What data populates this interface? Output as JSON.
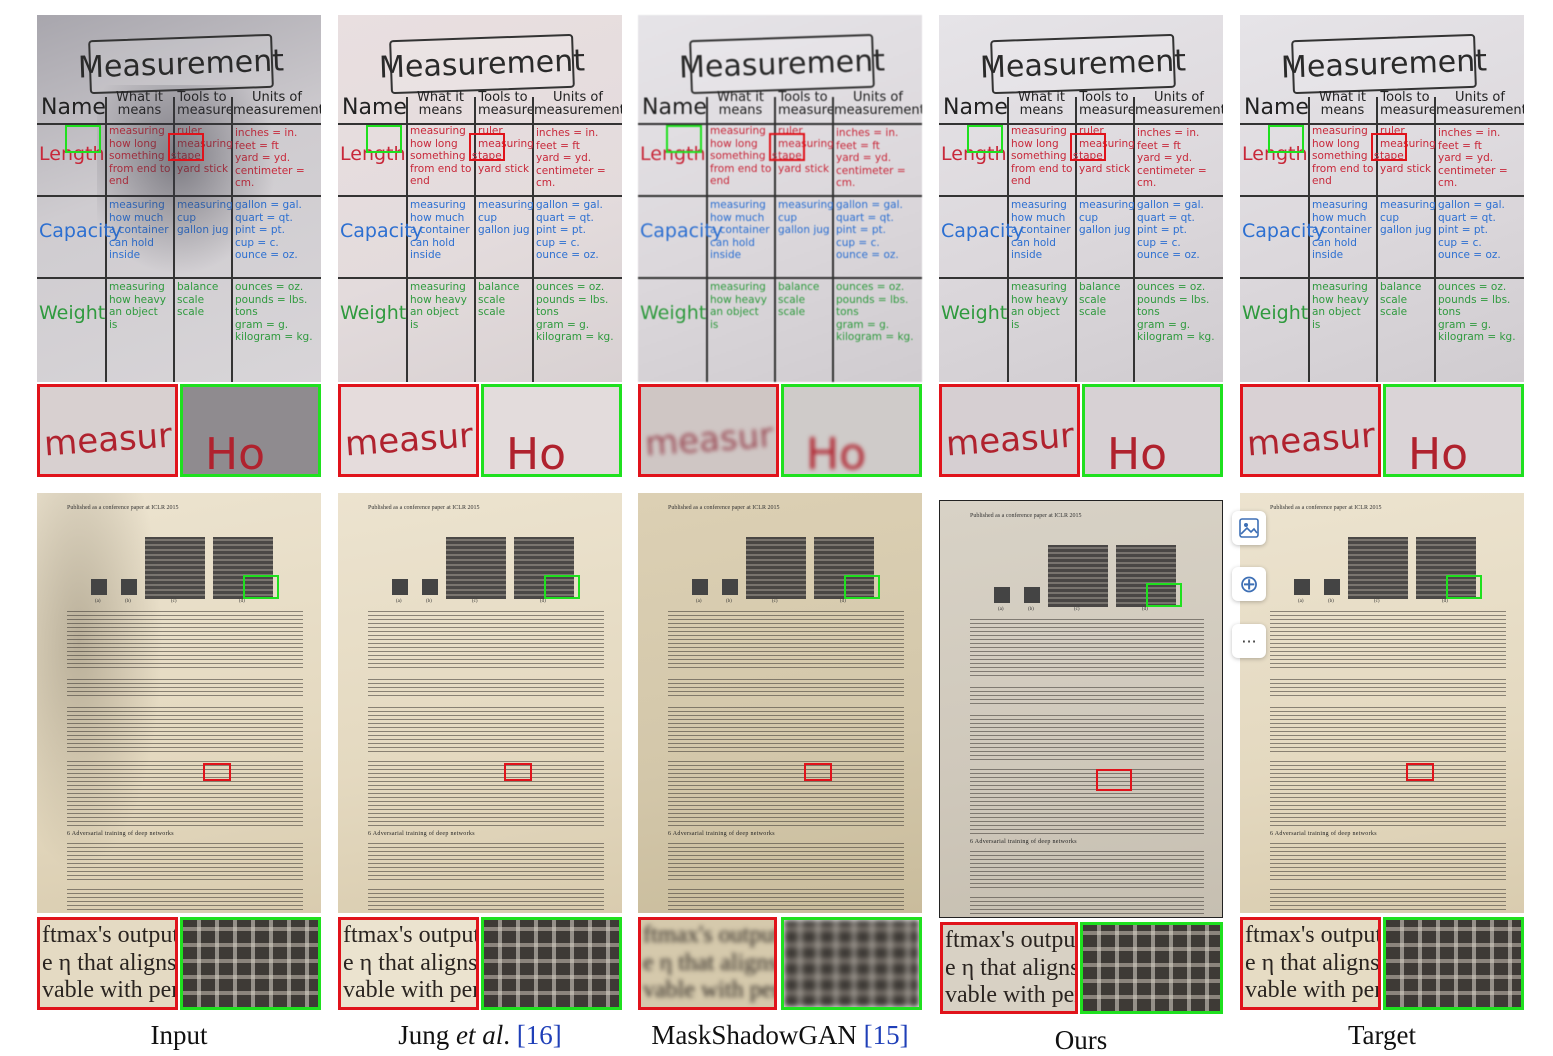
{
  "captions": {
    "input": "Input",
    "jung": "Jung ",
    "jung_etal": "et al",
    "jung_dot": ". ",
    "jung_ref": "[16]",
    "maskshadow": "MaskShadowGAN ",
    "maskshadow_ref": "[15]",
    "ours": "Ours",
    "target": "Target"
  },
  "chart": {
    "title": "Measurement",
    "headers": {
      "name": "Name",
      "what": "What it means",
      "tools": "Tools to measure",
      "units": "Units of measurement"
    },
    "rows": [
      {
        "label": "Length",
        "meaning": "measuring\nhow long\nsomething is\nfrom end to\nend",
        "tools": "ruler\nmeasuring\ntape\nyard stick",
        "units": "inches = in.\nfeet = ft\nyard = yd.\ncentimeter = cm."
      },
      {
        "label": "Capacity",
        "meaning": "measuring\nhow much\na container\ncan hold\ninside",
        "tools": "measuring\ncup\ngallon jug",
        "units": "gallon = gal.\nquart = qt.\npint = pt.\ncup = c.\nounce = oz."
      },
      {
        "label": "Weight",
        "meaning": "measuring\nhow heavy\nan object\nis",
        "tools": "balance\nscale\nscale",
        "units": "ounces = oz.\npounds = lbs.\ntons\ngram = g.\nkilogram = kg."
      }
    ]
  },
  "zoom_text": {
    "measur": "measur",
    "len_fragment": "Ho"
  },
  "doc": {
    "header": "Published as a conference paper at ICLR 2015",
    "sublabels": [
      "(a)",
      "(b)",
      "(c)",
      "(d)"
    ],
    "section": "6   Adversarial training of deep networks",
    "zoom_lines": "ftmax's output\ne η that aligns\nvable with per"
  },
  "colors": {
    "red_box": "#e0131b",
    "green_box": "#1fe01f",
    "length": "#c8283a",
    "capacity": "#2c6fd1",
    "weight": "#2f9a3e",
    "link": "#1f3fb8"
  },
  "side_icons": [
    "image-icon",
    "zoom-in-icon",
    "more-icon"
  ],
  "side_icon_glyphs": {
    "zoom": "⊕",
    "more": "···"
  }
}
